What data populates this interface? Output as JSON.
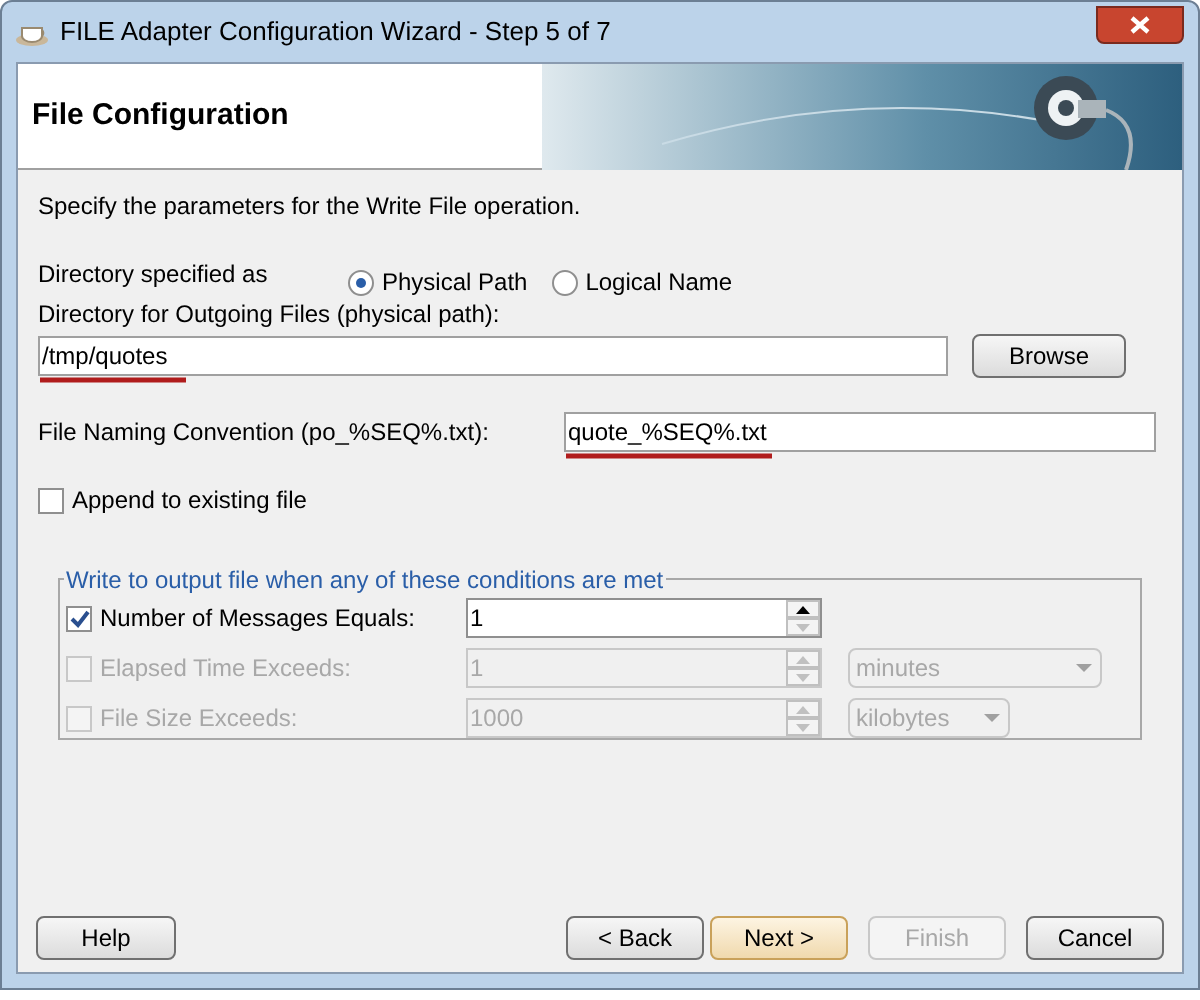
{
  "window": {
    "title": "FILE Adapter Configuration Wizard - Step 5 of 7"
  },
  "header": {
    "title": "File Configuration"
  },
  "instruction": "Specify the parameters for the Write File operation.",
  "directory_type": {
    "label": "Directory specified as",
    "options": [
      {
        "label": "Physical Path",
        "selected": true
      },
      {
        "label": "Logical Name",
        "selected": false
      }
    ]
  },
  "directory": {
    "label": "Directory for Outgoing Files (physical path):",
    "value": "/tmp/quotes",
    "button": "Browse"
  },
  "naming": {
    "label": "File Naming Convention (po_%SEQ%.txt):",
    "value": "quote_%SEQ%.txt"
  },
  "append": {
    "label": "Append to existing file",
    "checked": false
  },
  "conditions": {
    "title": "Write to output file when any of these conditions are met",
    "rows": [
      {
        "label": "Number of Messages Equals:",
        "checked": true,
        "disabled": false,
        "value": "1"
      },
      {
        "label": "Elapsed Time Exceeds:",
        "checked": false,
        "disabled": true,
        "value": "1",
        "unit": "minutes"
      },
      {
        "label": "File Size Exceeds:",
        "checked": false,
        "disabled": true,
        "value": "1000",
        "unit": "kilobytes"
      }
    ]
  },
  "help_button": {
    "label": "Help"
  },
  "nav_buttons": [
    {
      "label": "< Back",
      "default": false,
      "disabled": false
    },
    {
      "label": "Next >",
      "default": true,
      "disabled": false
    },
    {
      "label": "Finish",
      "default": false,
      "disabled": true
    },
    {
      "label": "Cancel",
      "default": false,
      "disabled": false
    }
  ]
}
